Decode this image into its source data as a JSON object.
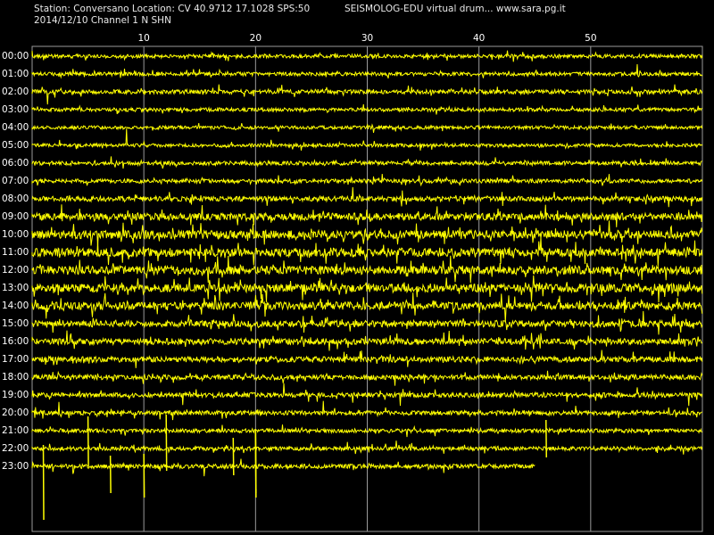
{
  "header": {
    "station_line": "Station: Conversano Location: CV 40.9712 17.1028 SPS:50",
    "date_line": "2014/12/10  Channel 1 N SHN",
    "app_line": "SEISMOLOG-EDU virtual drum... www.sara.pg.it"
  },
  "chart_data": {
    "type": "line",
    "title": "",
    "xlabel": "",
    "ylabel": "",
    "x_ticks": [
      10,
      20,
      30,
      40,
      50
    ],
    "xlim": [
      0,
      60
    ],
    "grid": true,
    "trace_color": "#ffff00",
    "background_color": "#000000",
    "grid_color": "#9a9a9a",
    "rows": [
      {
        "label": "00:00",
        "activity": 0.25,
        "end_minute": 60
      },
      {
        "label": "01:00",
        "activity": 0.25,
        "end_minute": 60
      },
      {
        "label": "02:00",
        "activity": 0.35,
        "end_minute": 60
      },
      {
        "label": "03:00",
        "activity": 0.25,
        "end_minute": 60
      },
      {
        "label": "04:00",
        "activity": 0.2,
        "end_minute": 60
      },
      {
        "label": "05:00",
        "activity": 0.2,
        "end_minute": 60
      },
      {
        "label": "06:00",
        "activity": 0.3,
        "end_minute": 60
      },
      {
        "label": "07:00",
        "activity": 0.3,
        "end_minute": 60
      },
      {
        "label": "08:00",
        "activity": 0.45,
        "end_minute": 60
      },
      {
        "label": "09:00",
        "activity": 0.8,
        "end_minute": 60
      },
      {
        "label": "10:00",
        "activity": 1.0,
        "end_minute": 60
      },
      {
        "label": "11:00",
        "activity": 1.0,
        "end_minute": 60
      },
      {
        "label": "12:00",
        "activity": 1.0,
        "end_minute": 60
      },
      {
        "label": "13:00",
        "activity": 1.0,
        "end_minute": 60
      },
      {
        "label": "14:00",
        "activity": 0.9,
        "end_minute": 60
      },
      {
        "label": "15:00",
        "activity": 0.7,
        "end_minute": 60
      },
      {
        "label": "16:00",
        "activity": 0.65,
        "end_minute": 60
      },
      {
        "label": "17:00",
        "activity": 0.55,
        "end_minute": 60
      },
      {
        "label": "18:00",
        "activity": 0.45,
        "end_minute": 60
      },
      {
        "label": "19:00",
        "activity": 0.4,
        "end_minute": 60
      },
      {
        "label": "20:00",
        "activity": 0.35,
        "end_minute": 60
      },
      {
        "label": "21:00",
        "activity": 0.3,
        "end_minute": 60
      },
      {
        "label": "22:00",
        "activity": 0.3,
        "end_minute": 60
      },
      {
        "label": "23:00",
        "activity": 0.35,
        "end_minute": 45
      }
    ]
  }
}
